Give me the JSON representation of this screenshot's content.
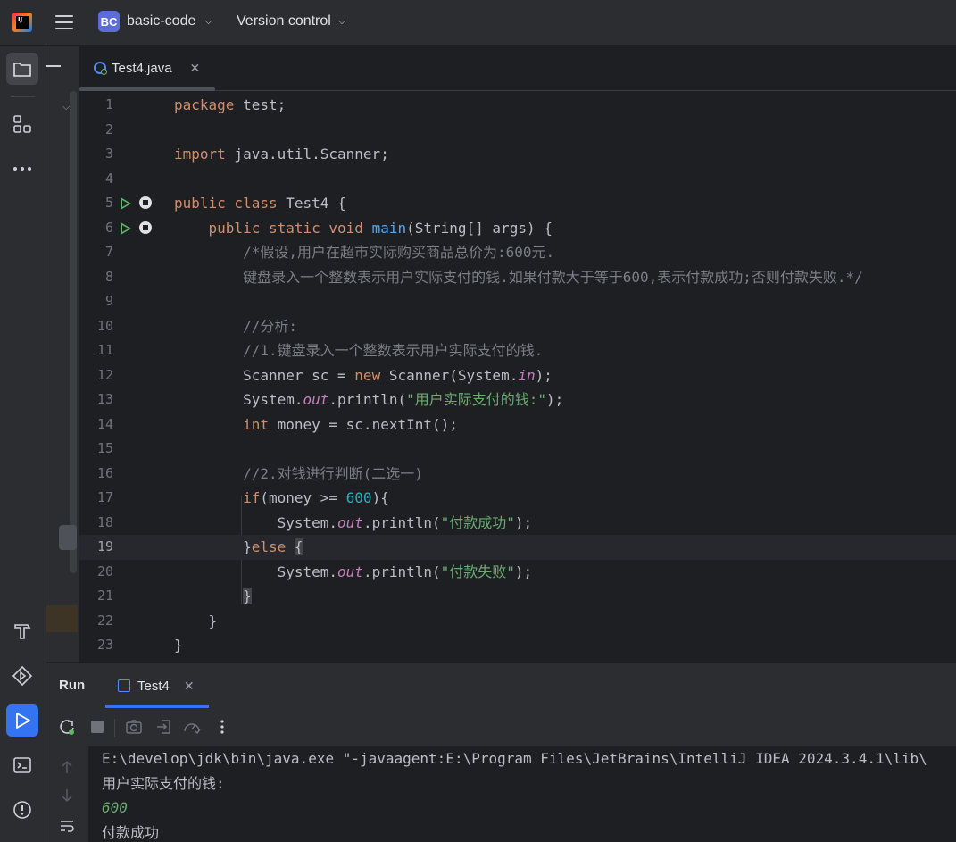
{
  "titlebar": {
    "project_badge": "BC",
    "project_name": "basic-code",
    "vcs_label": "Version control"
  },
  "editor_tab": {
    "label": "Test4.java"
  },
  "code": [
    {
      "n": "1",
      "html": "<span class=\"kw\">package</span> test;"
    },
    {
      "n": "2",
      "html": ""
    },
    {
      "n": "3",
      "html": "<span class=\"kw\">import</span> java.util.Scanner;"
    },
    {
      "n": "4",
      "html": ""
    },
    {
      "n": "5",
      "html": "<span class=\"kw\">public class</span> Test4 {",
      "run": true
    },
    {
      "n": "6",
      "html": "    <span class=\"kw\">public static void</span> <span class=\"fn\">main</span>(String[] args) {",
      "run": true
    },
    {
      "n": "7",
      "html": "        <span class=\"cm\">/*假设,用户在超市实际购买商品总价为:600元.</span>"
    },
    {
      "n": "8",
      "html": "        <span class=\"cm\">键盘录入一个整数表示用户实际支付的钱.如果付款大于等于600,表示付款成功;否则付款失败.*/</span>"
    },
    {
      "n": "9",
      "html": ""
    },
    {
      "n": "10",
      "html": "        <span class=\"cm\">//分析:</span>"
    },
    {
      "n": "11",
      "html": "        <span class=\"cm\">//1.键盘录入一个整数表示用户实际支付的钱.</span>"
    },
    {
      "n": "12",
      "html": "        Scanner sc = <span class=\"kw\">new</span> Scanner(System.<span class=\"fd\">in</span>);"
    },
    {
      "n": "13",
      "html": "        System.<span class=\"fd\">out</span>.println(<span class=\"st\">\"用户实际支付的钱:\"</span>);"
    },
    {
      "n": "14",
      "html": "        <span class=\"kw\">int</span> money = sc.nextInt();"
    },
    {
      "n": "15",
      "html": ""
    },
    {
      "n": "16",
      "html": "        <span class=\"cm\">//2.对钱进行判断(二选一)</span>"
    },
    {
      "n": "17",
      "html": "        <span class=\"kw\">if</span>(money >= <span class=\"nm\">600</span>){"
    },
    {
      "n": "18",
      "html": "            System.<span class=\"fd\">out</span>.println(<span class=\"st\">\"付款成功\"</span>);"
    },
    {
      "n": "19",
      "html": "        }<span class=\"kw\">else</span> <span class=\"brk\">{</span>",
      "current": true
    },
    {
      "n": "20",
      "html": "            System.<span class=\"fd\">out</span>.println(<span class=\"st\">\"付款失败\"</span>);"
    },
    {
      "n": "21",
      "html": "        <span class=\"brk\">}</span>"
    },
    {
      "n": "22",
      "html": "    }"
    },
    {
      "n": "23",
      "html": "}"
    }
  ],
  "run_panel": {
    "title": "Run",
    "tab_label": "Test4"
  },
  "console": {
    "lines": [
      {
        "text": "E:\\develop\\jdk\\bin\\java.exe \"-javaagent:E:\\Program Files\\JetBrains\\IntelliJ IDEA 2024.3.4.1\\lib\\",
        "kind": "cmd"
      },
      {
        "text": "用户实际支付的钱:",
        "kind": "out"
      },
      {
        "text": "600",
        "kind": "input"
      },
      {
        "text": "付款成功",
        "kind": "out"
      }
    ]
  },
  "colors": {
    "accent": "#3574f0",
    "keyword": "#cf8e6d",
    "string": "#6aab73",
    "number": "#2aacb8",
    "field": "#c77dbb",
    "comment": "#7a7e85",
    "method": "#56a8f5"
  }
}
